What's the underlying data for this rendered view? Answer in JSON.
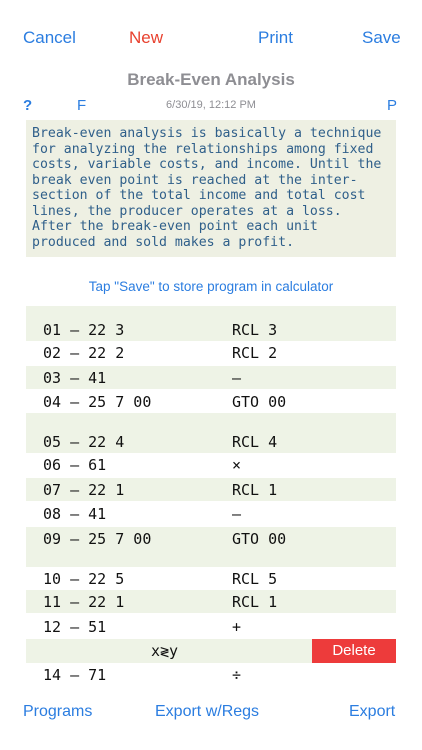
{
  "toolbar": {
    "cancel": "Cancel",
    "new": "New",
    "print": "Print",
    "save": "Save"
  },
  "header": {
    "title": "Break-Even Analysis",
    "help": "?",
    "f": "F",
    "date": "6/30/19, 12:12 PM",
    "p": "P"
  },
  "description": "Break-even analysis is basically a technique\nfor analyzing the relationships among fixed\ncosts, variable costs, and income. Until the\nbreak even point is reached at the inter-\nsection of the total income and total cost\nlines, the producer operates at a loss.\nAfter the break-even point each unit\nproduced and sold makes a profit.",
  "hint": "Tap \"Save\" to store program in calculator",
  "program": [
    {
      "code": "01 – 22 3",
      "op": "RCL 3"
    },
    {
      "code": "02 – 22 2",
      "op": "RCL 2"
    },
    {
      "code": "03 – 41",
      "op": "–"
    },
    {
      "code": "04 – 25 7 00",
      "op": "GTO 00"
    },
    {
      "code": "05 – 22 4",
      "op": "RCL 4"
    },
    {
      "code": "06 – 61",
      "op": "×"
    },
    {
      "code": "07 – 22 1",
      "op": "RCL 1"
    },
    {
      "code": "08 – 41",
      "op": "–"
    },
    {
      "code": "09 – 25 7 00",
      "op": "GTO 00"
    },
    {
      "code": "10 – 22 5",
      "op": "RCL 5"
    },
    {
      "code": "11 – 22 1",
      "op": "RCL 1"
    },
    {
      "code": "12 – 51",
      "op": "+"
    },
    {
      "code": "",
      "op": "x≷y"
    },
    {
      "code": "14 – 71",
      "op": "÷"
    }
  ],
  "delete_label": "Delete",
  "bottom": {
    "programs": "Programs",
    "export_regs": "Export w/Regs",
    "export": "Export"
  },
  "colors": {
    "accent": "#2b7de0",
    "new": "#e8412e",
    "delete": "#ed3b3b",
    "row_shaded": "#eef3e6"
  }
}
